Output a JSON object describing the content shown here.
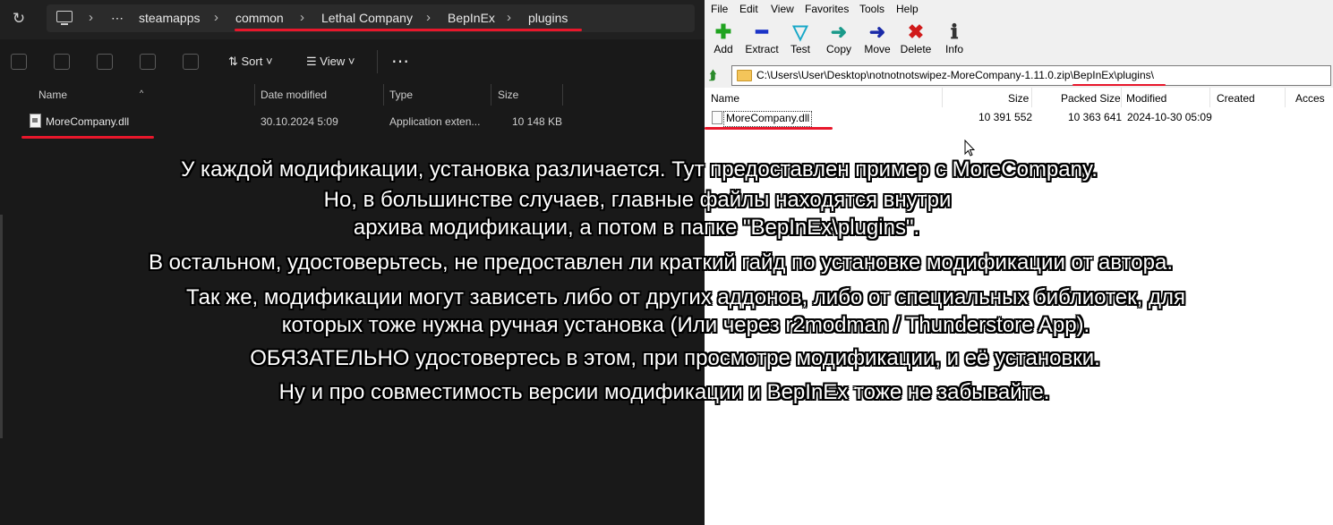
{
  "explorer": {
    "breadcrumb": [
      "steamapps",
      "common",
      "Lethal Company",
      "BepInEx",
      "plugins"
    ],
    "ellipsis": "⋯",
    "toolbar": {
      "sort_label": "Sort",
      "view_label": "View",
      "more": "⋯"
    },
    "columns": [
      "Name",
      "Date modified",
      "Type",
      "Size"
    ],
    "file": {
      "name": "MoreCompany.dll",
      "date": "30.10.2024 5:09",
      "type": "Application exten...",
      "size": "10 148 KB"
    }
  },
  "zip": {
    "menu": [
      "File",
      "Edit",
      "View",
      "Favorites",
      "Tools",
      "Help"
    ],
    "toolbar": [
      "Add",
      "Extract",
      "Test",
      "Copy",
      "Move",
      "Delete",
      "Info"
    ],
    "path": "C:\\Users\\User\\Desktop\\notnotnotswipez-MoreCompany-1.11.0.zip\\BepInEx\\plugins\\",
    "columns": [
      "Name",
      "Size",
      "Packed Size",
      "Modified",
      "Created",
      "Acces"
    ],
    "file": {
      "name": "MoreCompany.dll",
      "size": "10 391 552",
      "packed": "10 363 641",
      "modified": "2024-10-30 05:09"
    }
  },
  "overlay": [
    "У каждой модификации, установка различается. Тут предоставлен пример с MoreCompany.",
    "Но, в большинстве случаев, главные файлы находятся внутри",
    "архива модификации, а потом в папке \"BepInEx\\plugins\".",
    "В остальном, удостоверьтесь, не предоставлен ли краткий гайд по установке модификации от автора.",
    "Так же, модификации могут зависеть либо от других аддонов, либо от специальных библиотек, для",
    "которых тоже нужна ручная установка (Или через r2modman / Thunderstore App).",
    "ОБЯЗАТЕЛЬНО удостовертесь в этом, при просмотре модификации, и её установки.",
    "Ну и про совместимость версии модификации и BepInEx тоже не забывайте."
  ],
  "colors": {
    "underline": "#e8172b",
    "explorer_bg": "#191919",
    "zip_bg": "#ffffff"
  }
}
